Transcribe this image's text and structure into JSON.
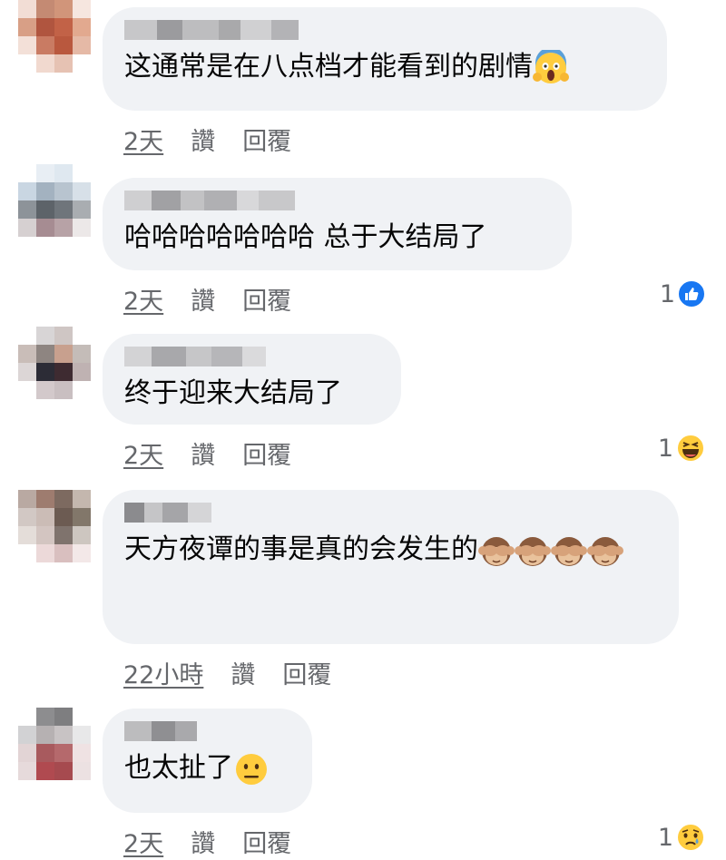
{
  "comments": [
    {
      "text": "这通常是在八点档才能看到的剧情",
      "emoji": "face-screaming-in-fear",
      "time": "2天",
      "like_label": "讚",
      "reply_label": "回覆",
      "reaction_count": "",
      "reaction_icon": ""
    },
    {
      "text": "哈哈哈哈哈哈哈 总于大结局了",
      "emoji": "",
      "time": "2天",
      "like_label": "讚",
      "reply_label": "回覆",
      "reaction_count": "1",
      "reaction_icon": "like-icon"
    },
    {
      "text": "终于迎来大结局了",
      "emoji": "",
      "time": "2天",
      "like_label": "讚",
      "reply_label": "回覆",
      "reaction_count": "1",
      "reaction_icon": "haha-icon"
    },
    {
      "text": "天方夜谭的事是真的会发生的",
      "emoji": "see-no-evil-monkey x4",
      "time": "22小時",
      "like_label": "讚",
      "reply_label": "回覆",
      "reaction_count": "",
      "reaction_icon": ""
    },
    {
      "text": "也太扯了",
      "emoji": "neutral-face",
      "time": "2天",
      "like_label": "讚",
      "reply_label": "回覆",
      "reaction_count": "1",
      "reaction_icon": "sad-icon"
    }
  ],
  "colors": {
    "bubble": "#f0f2f5",
    "meta_text": "#65676b",
    "like_blue": "#1877f2",
    "emoji_yellow": "#ffcc3e"
  }
}
